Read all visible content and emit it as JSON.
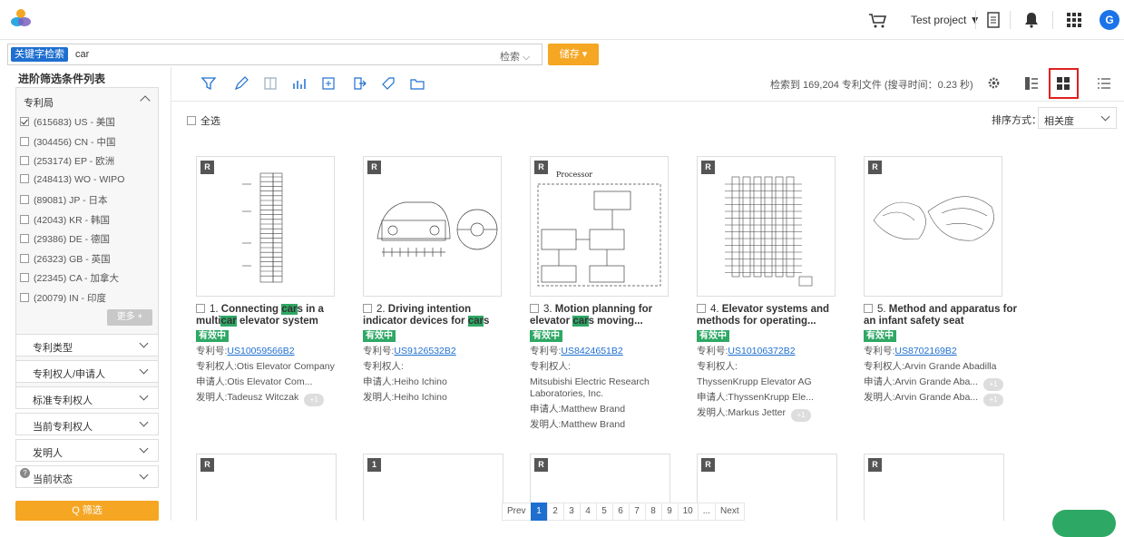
{
  "header": {
    "project": "Test project ▼",
    "avatar": "G"
  },
  "search": {
    "tag": "关键字检索",
    "query": "car",
    "mode": "检索 ⌵",
    "save": "储存 ▾"
  },
  "sidebar": {
    "title": "进阶筛选条件列表",
    "office_header": "专利局",
    "countries": [
      {
        "label": "(615683)  US - 美国",
        "checked": true
      },
      {
        "label": "(304456)  CN - 中国",
        "checked": false
      },
      {
        "label": "(253174)  EP - 欧洲",
        "checked": false
      },
      {
        "label": "(248413)  WO - WIPO",
        "checked": false
      },
      {
        "label": "(89081)  JP - 日本",
        "checked": false
      },
      {
        "label": "(42043)  KR - 韩国",
        "checked": false
      },
      {
        "label": "(29386)  DE - 德国",
        "checked": false
      },
      {
        "label": "(26323)  GB - 英国",
        "checked": false
      },
      {
        "label": "(22345)  CA - 加拿大",
        "checked": false
      },
      {
        "label": "(20079)  IN - 印度",
        "checked": false
      }
    ],
    "more": "更多 +",
    "sections": [
      "专利类型",
      "专利权人/申请人",
      "标准专利权人",
      "当前专利权人",
      "发明人",
      "当前状态"
    ],
    "filter": "Q 筛选"
  },
  "toolbar": {
    "result_text": "检索到 169,204 专利文件 (搜寻时间：0.23 秒)",
    "select_all": "全选",
    "sort_label": "排序方式：",
    "sort_value": "相关度"
  },
  "cards": [
    {
      "num": "1.",
      "t1": "Connecting ",
      "h1": "car",
      "t2": "s in a multi",
      "h2": "car",
      "t3": " elevator system",
      "status": "有效中",
      "pn_label": "专利号:",
      "pn": "US10059566B2",
      "l1": "专利权人:Otis Elevator Company",
      "l2": "申请人:Otis Elevator Com...",
      "l3": "发明人:Tadeusz Witczak",
      "plus": "+1"
    },
    {
      "num": "2.",
      "t1": "Driving intention indicator devices for ",
      "h1": "car",
      "t2": "s",
      "h2": "",
      "t3": "",
      "status": "有效中",
      "pn_label": "专利号:",
      "pn": "US9126532B2",
      "l1": "专利权人:",
      "l2": "申请人:Heiho Ichino",
      "l3": "发明人:Heiho Ichino",
      "plus": ""
    },
    {
      "num": "3.",
      "t1": "Motion planning for elevator ",
      "h1": "car",
      "t2": "s moving...",
      "h2": "",
      "t3": "",
      "status": "有效中",
      "pn_label": "专利号:",
      "pn": "US8424651B2",
      "l1": "专利权人:",
      "l2": "Mitsubishi Electric Research",
      "l3": "Laboratories, Inc.",
      "l4": "申请人:Matthew Brand",
      "l5": "发明人:Matthew Brand",
      "plus": ""
    },
    {
      "num": "4.",
      "t1": "Elevator systems and methods for operating...",
      "h1": "",
      "t2": "",
      "h2": "",
      "t3": "",
      "status": "有效中",
      "pn_label": "专利号:",
      "pn": "US10106372B2",
      "l1": "专利权人:",
      "l2": "ThyssenKrupp Elevator AG",
      "l3": "申请人:ThyssenKrupp Ele...",
      "l4": "发明人:Markus Jetter",
      "plus": "+1"
    },
    {
      "num": "5.",
      "t1": "Method and apparatus for an infant safety seat",
      "h1": "",
      "t2": "",
      "h2": "",
      "t3": "",
      "status": "有效中",
      "pn_label": "专利号:",
      "pn": "US8702169B2",
      "l1": "专利权人:Arvin Grande Abadilla",
      "l2": "申请人:Arvin Grande Aba...",
      "l3": "发明人:Arvin Grande Aba...",
      "plus": "+1"
    }
  ],
  "row2_badges": [
    "R",
    "1",
    "R",
    "R",
    "R"
  ],
  "thumb_badge": "R",
  "pager": {
    "prev": "Prev",
    "pages": [
      "1",
      "2",
      "3",
      "4",
      "5",
      "6",
      "7",
      "8",
      "9",
      "10",
      "..."
    ],
    "next": "Next"
  }
}
